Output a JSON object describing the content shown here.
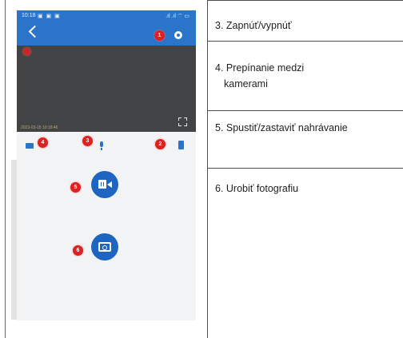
{
  "status_bar": {
    "time": "10:18",
    "icons_left": "▣ ▣ ▣",
    "icons_right": ".ıl .ıl ⌔ ▭"
  },
  "video": {
    "timestamp": "2023-03-15 10:18:46"
  },
  "badges": [
    "1",
    "2",
    "3",
    "4",
    "5",
    "6"
  ],
  "descriptions": [
    {
      "lines": [
        "3. Zapnúť/vypnúť"
      ]
    },
    {
      "lines": [
        "4. Prepínanie medzi",
        "kamerami"
      ]
    },
    {
      "lines": [
        "5. Spustiť/zastaviť nahrávanie"
      ]
    },
    {
      "lines": [
        "6. Urobiť fotografiu"
      ]
    }
  ],
  "colors": {
    "app_bar": "#2a74c9",
    "action_button": "#1d65c1",
    "badge": "#e02020",
    "video_bg": "#424345"
  }
}
